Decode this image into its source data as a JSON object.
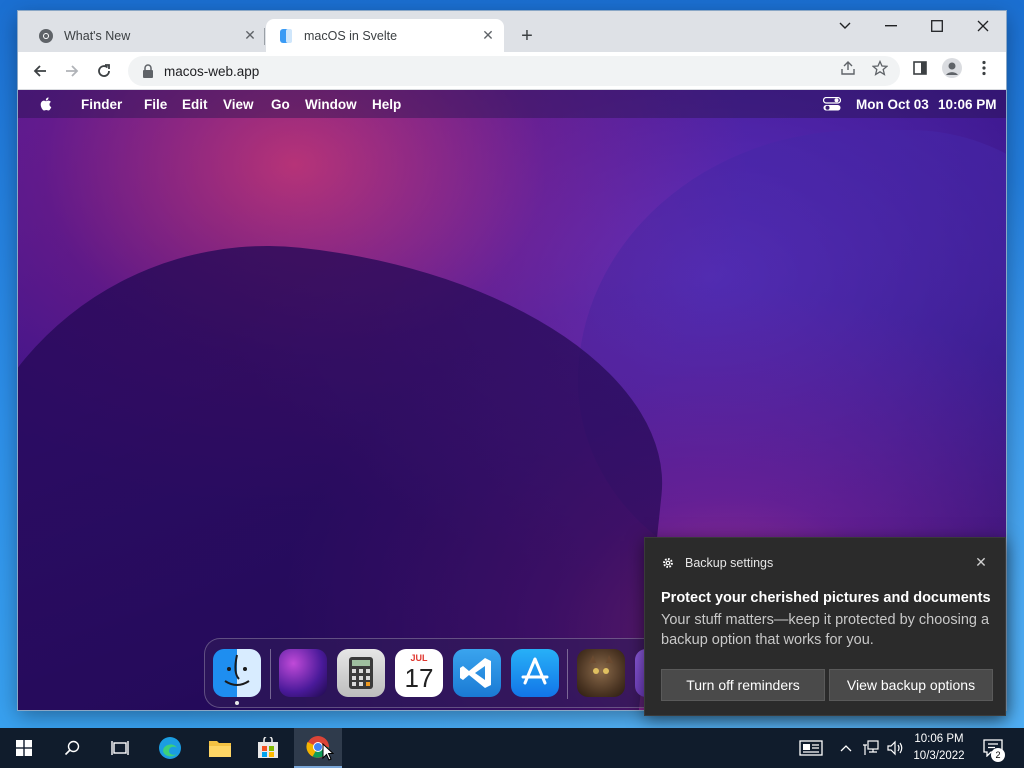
{
  "browser": {
    "tabs": [
      {
        "label": "What's New",
        "active": false
      },
      {
        "label": "macOS in Svelte",
        "active": true
      }
    ],
    "url": "macos-web.app",
    "window_controls": [
      "chevron-down-icon",
      "minimize-icon",
      "maximize-icon",
      "close-icon"
    ]
  },
  "macos": {
    "menubar": {
      "app_name": "Finder",
      "items": [
        "File",
        "Edit",
        "View",
        "Go",
        "Window",
        "Help"
      ],
      "date": "Mon Oct 03",
      "time": "10:06 PM"
    },
    "dock": {
      "apps": [
        "Finder",
        "Launchpad",
        "Calculator",
        "Calendar",
        "VS Code",
        "App Store",
        "Cat",
        "Other"
      ],
      "calendar_month": "JUL",
      "calendar_day": "17"
    }
  },
  "notification": {
    "app": "Backup settings",
    "title": "Protect your cherished pictures and documents",
    "message": "Your stuff matters—keep it protected by choosing a backup option that works for you.",
    "buttons": [
      "Turn off reminders",
      "View backup options"
    ]
  },
  "taskbar": {
    "time": "10:06 PM",
    "date": "10/3/2022",
    "notification_count": "2"
  },
  "colors": {
    "taskbar_bg": "#101c2c",
    "toast_bg": "#2b2b2b",
    "accent": "#1b6fd1"
  }
}
